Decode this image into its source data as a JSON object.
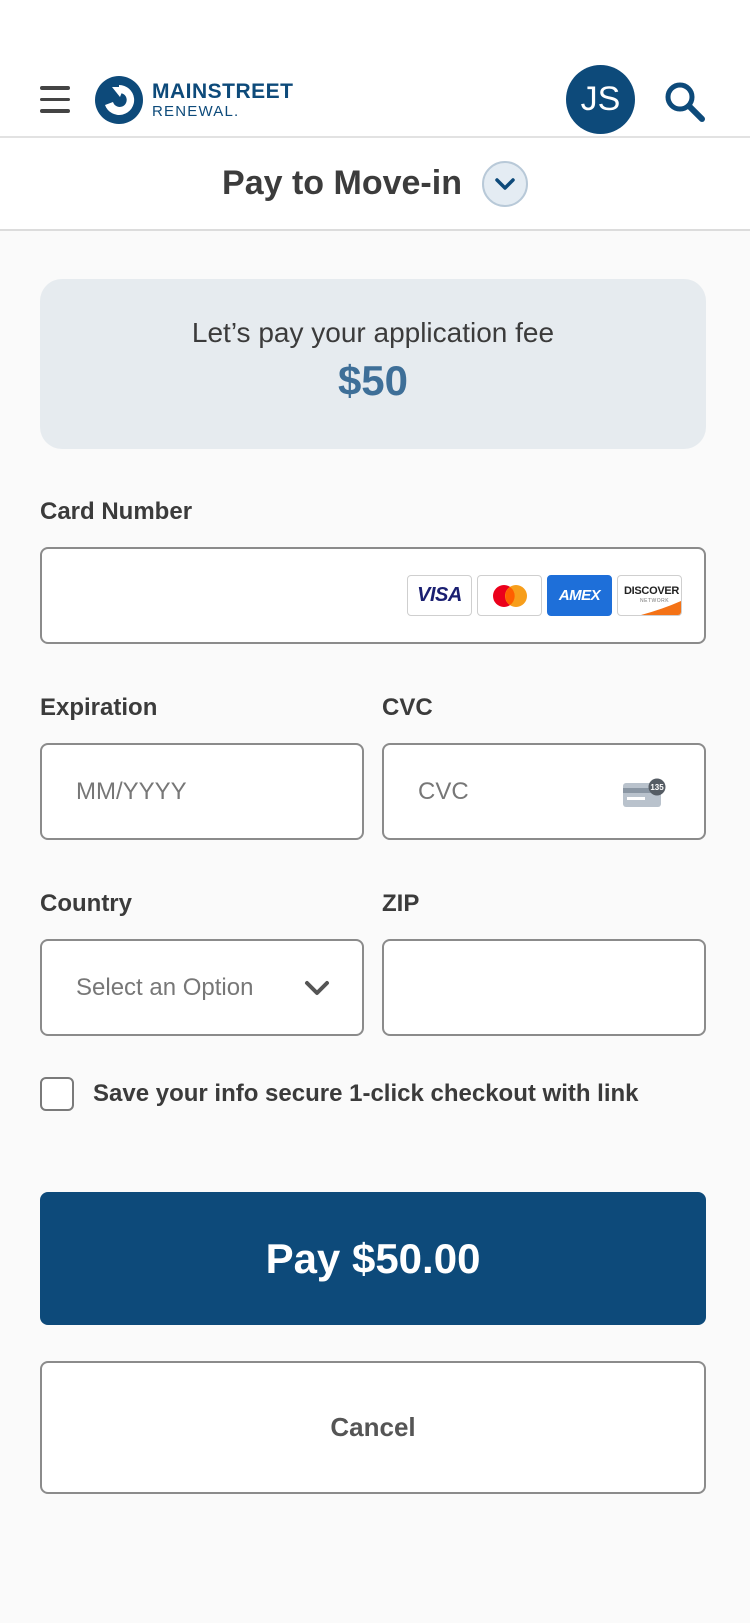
{
  "header": {
    "logo_main": "MAINSTREET",
    "logo_sub": "RENEWAL.",
    "avatar_initials": "JS"
  },
  "subheader": {
    "title": "Pay to Move-in"
  },
  "fee": {
    "text": "Let’s pay your application fee",
    "amount": "$50"
  },
  "form": {
    "card_number_label": "Card Number",
    "card_number_value": "",
    "card_brands": {
      "visa": "VISA",
      "amex": "AMEX",
      "discover": "DISCOVER",
      "discover_sub": "NETWORK"
    },
    "expiration_label": "Expiration",
    "expiration_placeholder": "MM/YYYY",
    "cvc_label": "CVC",
    "cvc_placeholder": "CVC",
    "cvc_icon_number": "135",
    "country_label": "Country",
    "country_selected": "Select an Option",
    "zip_label": "ZIP",
    "zip_value": "",
    "save_info_label": "Save your info secure 1-click checkout with link",
    "save_info_checked": false
  },
  "actions": {
    "pay_label": "Pay $50.00",
    "cancel_label": "Cancel"
  },
  "colors": {
    "brand": "#0d4a7a",
    "amount": "#3e6f98",
    "card_bg": "#e6ebef"
  }
}
